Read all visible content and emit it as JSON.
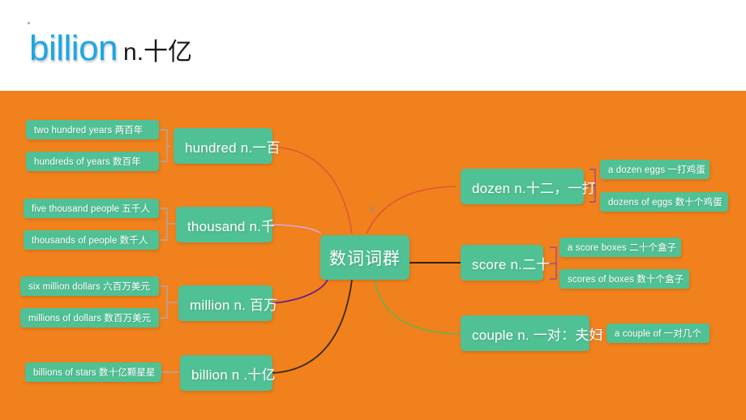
{
  "header": {
    "word_en": "billion",
    "word_cn": "n.十亿",
    "accent_blue": "#1ba7e4",
    "text_black": "#1a1a1a"
  },
  "theme": {
    "background_orange": "#f0811d",
    "node_green": "#4fc195",
    "node_text": "#ffffff",
    "header_background": "#ffffff"
  },
  "mindmap": {
    "center": {
      "label": "数词词群"
    },
    "left_branches": [
      {
        "label": "hundred n.一百",
        "wire_color": "#e2553a",
        "bracket_color": "#b0a9a2",
        "leaves": [
          {
            "label": "two hundred years 两百年"
          },
          {
            "label": "hundreds of years 数百年"
          }
        ]
      },
      {
        "label": "thousand n.千",
        "wire_color": "#d9a8de",
        "bracket_color": "#b0a9a2",
        "leaves": [
          {
            "label": "five thousand people 五千人"
          },
          {
            "label": "thousands of people 数千人"
          }
        ]
      },
      {
        "label": "million n. 百万",
        "wire_color": "#6b1f8c",
        "bracket_color": "#b0a9a2",
        "leaves": [
          {
            "label": "six million dollars 六百万美元"
          },
          {
            "label": "millions of dollars 数百万美元"
          }
        ]
      },
      {
        "label": "billion n .十亿",
        "wire_color": "#3a2a07",
        "bracket_color": "#b0a9a2",
        "leaves": [
          {
            "label": "billions of stars 数十亿颗星星"
          }
        ]
      }
    ],
    "right_branches": [
      {
        "label": "dozen n.十二，一打",
        "wire_color": "#e2553a",
        "bracket_color": "#9b4a8e",
        "leaves": [
          {
            "label": "a dozen eggs 一打鸡蛋"
          },
          {
            "label": "dozens of eggs 数十个鸡蛋"
          }
        ]
      },
      {
        "label": "score n.二十",
        "wire_color": "#1a1405",
        "bracket_color": "#9b4a8e",
        "leaves": [
          {
            "label": "a score boxes 二十个盒子"
          },
          {
            "label": "scores of boxes 数十个盒子"
          }
        ]
      },
      {
        "label": "couple n. 一对：夫妇",
        "wire_color": "#63b44a",
        "bracket_color": "#b0a9a2",
        "leaves": [
          {
            "label": "a couple of 一对几个"
          }
        ]
      }
    ]
  }
}
